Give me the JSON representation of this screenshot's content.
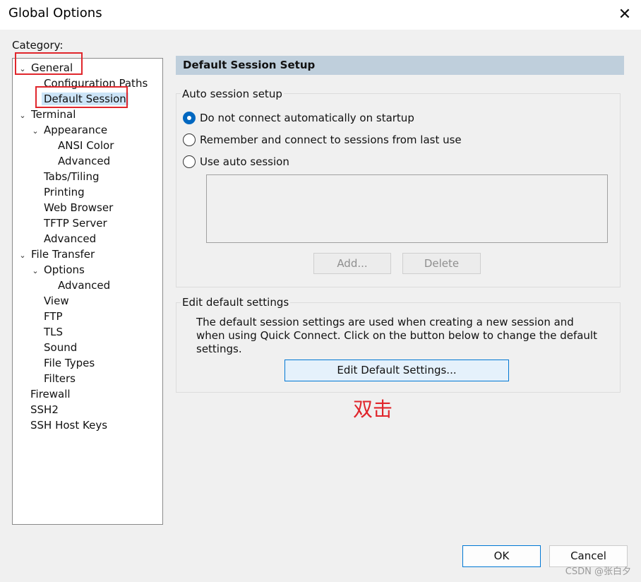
{
  "window": {
    "title": "Global Options",
    "close_glyph": "✕"
  },
  "category_label": "Category:",
  "tree": [
    {
      "label": "General",
      "expander": "⌄"
    },
    {
      "label": "Configuration Paths"
    },
    {
      "label": "Default Session",
      "selected": true
    },
    {
      "label": "Terminal",
      "expander": "⌄"
    },
    {
      "label": "Appearance",
      "expander": "⌄"
    },
    {
      "label": "ANSI Color"
    },
    {
      "label": "Advanced"
    },
    {
      "label": "Tabs/Tiling"
    },
    {
      "label": "Printing"
    },
    {
      "label": "Web Browser"
    },
    {
      "label": "TFTP Server"
    },
    {
      "label": "Advanced"
    },
    {
      "label": "File Transfer",
      "expander": "⌄"
    },
    {
      "label": "Options",
      "expander": "⌄"
    },
    {
      "label": "Advanced"
    },
    {
      "label": "View"
    },
    {
      "label": "FTP"
    },
    {
      "label": "TLS"
    },
    {
      "label": "Sound"
    },
    {
      "label": "File Types"
    },
    {
      "label": "Filters"
    },
    {
      "label": "Firewall"
    },
    {
      "label": "SSH2"
    },
    {
      "label": "SSH Host Keys"
    }
  ],
  "panel": {
    "header": "Default Session Setup",
    "auto_session": {
      "title": "Auto session setup",
      "options": [
        {
          "label": "Do not connect automatically on startup",
          "checked": true
        },
        {
          "label": "Remember and connect to sessions from last use",
          "checked": false
        },
        {
          "label": "Use auto session",
          "checked": false
        }
      ],
      "add_label": "Add...",
      "delete_label": "Delete"
    },
    "edit_defaults": {
      "title": "Edit default settings",
      "description": "The default session settings are used when creating a new session and when using Quick Connect.  Click on the button below to change the default settings.",
      "button_label": "Edit Default Settings..."
    }
  },
  "annotation": "双击",
  "footer": {
    "ok_label": "OK",
    "cancel_label": "Cancel"
  },
  "watermark": "CSDN @张白夕",
  "colors": {
    "annotation_red": "#e0262c",
    "selection": "#cce4f7",
    "accent": "#0078d4",
    "header_bg": "#bfcfdc"
  }
}
